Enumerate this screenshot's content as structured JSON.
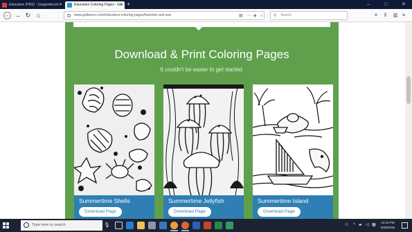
{
  "browser": {
    "tabs": [
      {
        "title": "Education (PBS) - Snagwebcom",
        "active": false
      },
      {
        "title": "Education Coloring Pages - Gu",
        "active": true
      }
    ],
    "new_tab_label": "+",
    "url": "www.gulbesco.com/educators-coloring-pages/hummer-and-sea",
    "search_placeholder": "Search",
    "window_controls": {
      "minimize": "–",
      "maximize": "□",
      "close": "✕"
    }
  },
  "page": {
    "heading": "Download & Print Coloring Pages",
    "subheading": "It couldn't be easier to get started.",
    "cards": [
      {
        "title": "Summertime Shells",
        "button": "Download Page",
        "icon": "shells-coloring-art"
      },
      {
        "title": "Summertime Jellyfish",
        "button": "Download Page",
        "icon": "jellyfish-coloring-art"
      },
      {
        "title": "Summertime Island",
        "button": "Download Page",
        "icon": "island-coloring-art"
      }
    ],
    "colors": {
      "panel": "#5fa04d",
      "card_footer": "#2f7fb4",
      "button_text": "#2f7fb4"
    }
  },
  "taskbar": {
    "search_placeholder": "Type here to search",
    "time": "10:15 PM",
    "date": "6/29/2018"
  }
}
